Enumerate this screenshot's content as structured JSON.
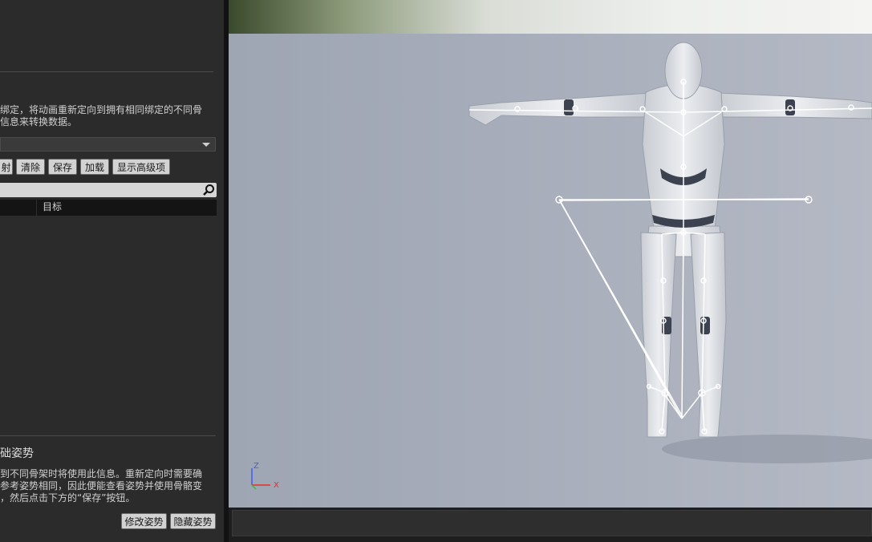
{
  "retarget": {
    "description_line1": "绑定，将动画重新定向到拥有相同绑定的不同骨",
    "description_line2": "信息来转换数据。",
    "buttons": {
      "map": "射",
      "clear": "清除",
      "save": "保存",
      "load": "加载",
      "show_advanced": "显示高级项"
    },
    "table": {
      "target_column": "目标"
    }
  },
  "base_pose": {
    "title": "础姿势",
    "description_line1": "到不同骨架时将使用此信息。重新定向时需要确",
    "description_line2": "参考姿势相同，因此便能查看姿势并使用骨骼变",
    "description_line3": "，然后点击下方的“保存”按钮。",
    "modify_button": "修改姿势",
    "hide_button": "隐藏姿势"
  },
  "viewport": {
    "axis_z": "Z",
    "axis_x": "X",
    "colors": {
      "axis_z": "#3b5bff",
      "axis_x": "#e0302a",
      "axis_y": "#2fbf3a"
    }
  }
}
